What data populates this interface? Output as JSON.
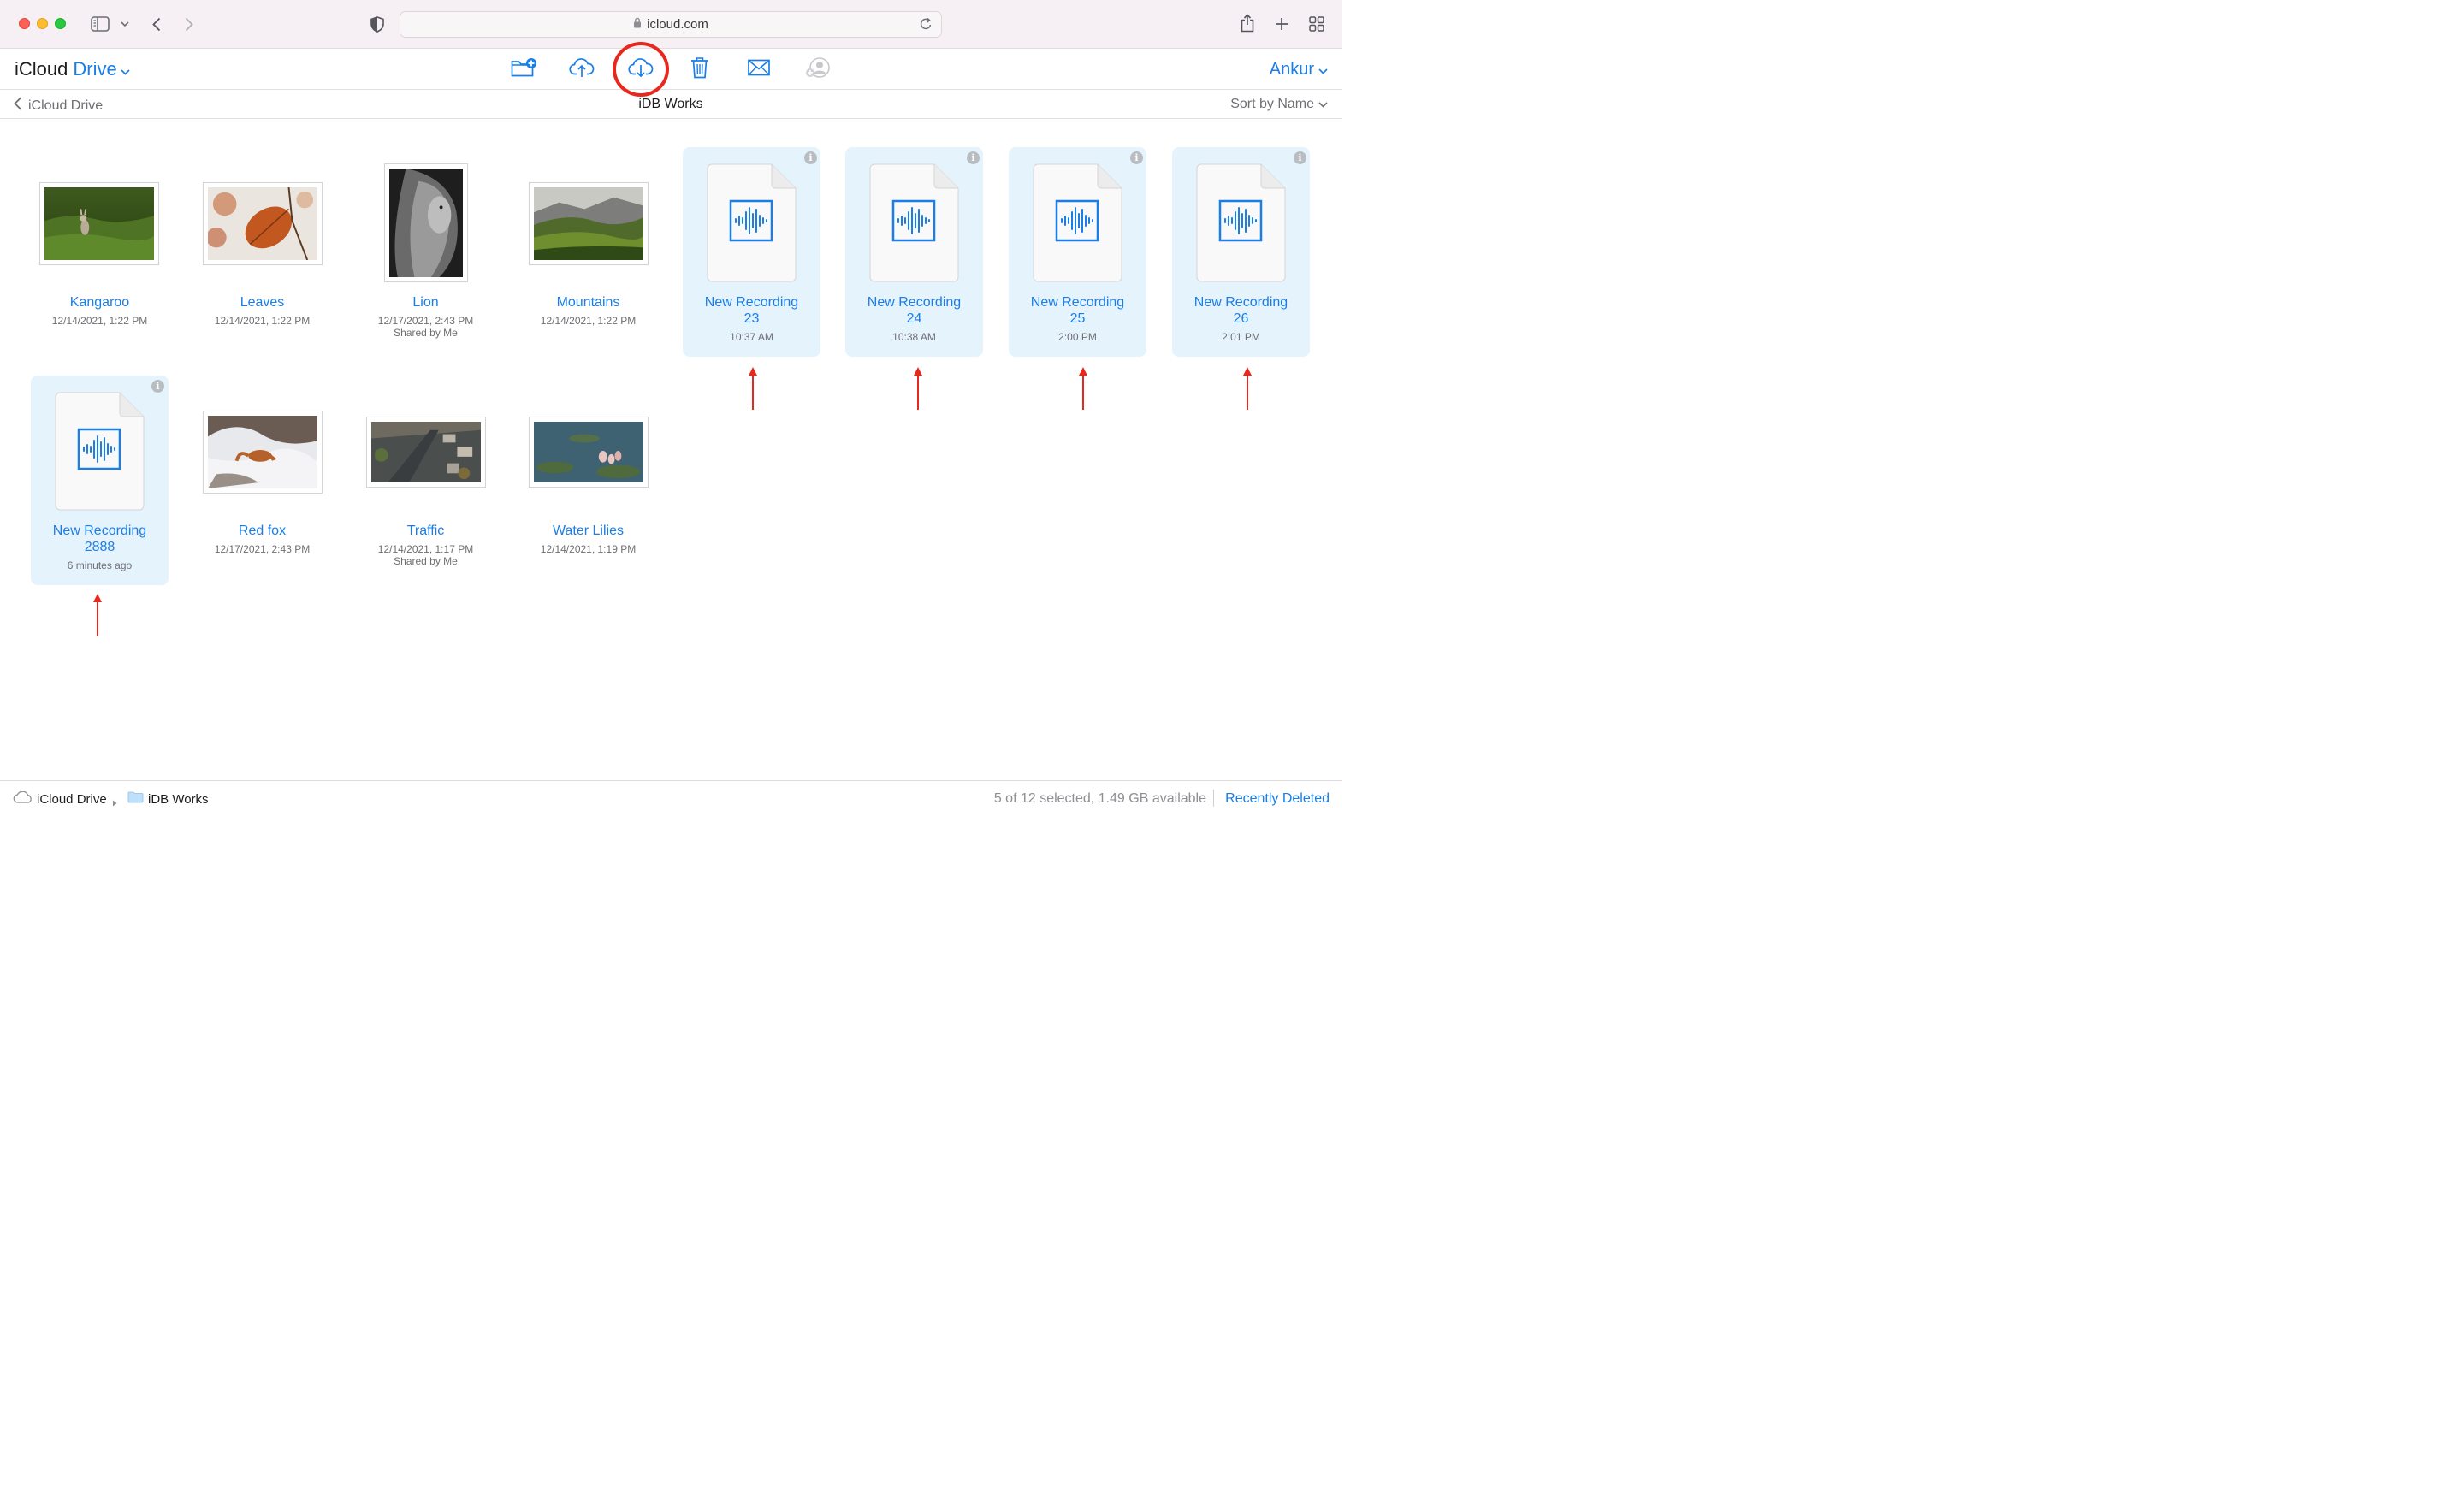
{
  "browser": {
    "url": "icloud.com",
    "icons": [
      "sidebar-icon",
      "chevron-down-icon",
      "back-icon",
      "forward-icon",
      "privacy-shield-icon",
      "lock-icon",
      "reload-icon",
      "share-icon",
      "new-tab-icon",
      "tab-overview-icon"
    ]
  },
  "header": {
    "brand_icloud": "iCloud",
    "brand_drive": "Drive",
    "user": "Ankur",
    "toolbar_icons": [
      "new-folder-icon",
      "upload-icon",
      "download-icon",
      "delete-icon",
      "email-icon",
      "add-person-icon"
    ]
  },
  "subnav": {
    "back_label": "iCloud Drive",
    "title": "iDB Works",
    "sort_label": "Sort by Name"
  },
  "files": [
    {
      "name": "Kangaroo",
      "meta1": "12/14/2021, 1:22 PM",
      "meta2": "",
      "kind": "image",
      "selected": false
    },
    {
      "name": "Leaves",
      "meta1": "12/14/2021, 1:22 PM",
      "meta2": "",
      "kind": "image",
      "selected": false
    },
    {
      "name": "Lion",
      "meta1": "12/17/2021, 2:43 PM",
      "meta2": "Shared by Me",
      "kind": "image",
      "selected": false
    },
    {
      "name": "Mountains",
      "meta1": "12/14/2021, 1:22 PM",
      "meta2": "",
      "kind": "image",
      "selected": false
    },
    {
      "name": "New Recording",
      "name2": "23",
      "meta1": "10:37 AM",
      "kind": "audio",
      "selected": true
    },
    {
      "name": "New Recording",
      "name2": "24",
      "meta1": "10:38 AM",
      "kind": "audio",
      "selected": true
    },
    {
      "name": "New Recording",
      "name2": "25",
      "meta1": "2:00 PM",
      "kind": "audio",
      "selected": true
    },
    {
      "name": "New Recording",
      "name2": "26",
      "meta1": "2:01 PM",
      "kind": "audio",
      "selected": true
    },
    {
      "name": "New Recording",
      "name2": "2888",
      "meta1": "6 minutes ago",
      "kind": "audio",
      "selected": true
    },
    {
      "name": "Red fox",
      "meta1": "12/17/2021, 2:43 PM",
      "meta2": "",
      "kind": "image",
      "selected": false
    },
    {
      "name": "Traffic",
      "meta1": "12/14/2021, 1:17 PM",
      "meta2": "Shared by Me",
      "kind": "image",
      "selected": false
    },
    {
      "name": "Water Lilies",
      "meta1": "12/14/2021, 1:19 PM",
      "meta2": "",
      "kind": "image",
      "selected": false
    }
  ],
  "info_glyph": "i",
  "footer": {
    "crumb_root": "iCloud Drive",
    "crumb_folder": "iDB Works",
    "status": "5 of 12 selected, 1.49 GB available",
    "recently_deleted": "Recently Deleted"
  },
  "colors": {
    "accent": "#1a7ee6",
    "selection": "#e5f3fd",
    "annotation": "#e8281c"
  }
}
